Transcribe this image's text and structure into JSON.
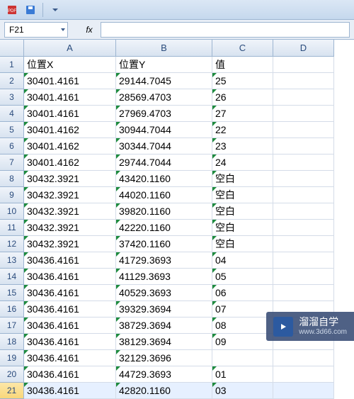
{
  "cell_reference": "F21",
  "fx_label": "fx",
  "columns": [
    "A",
    "B",
    "C",
    "D"
  ],
  "headers": {
    "A": "位置X",
    "B": "位置Y",
    "C": "值"
  },
  "rows": [
    {
      "n": 1,
      "A": "位置X",
      "B": "位置Y",
      "C": "值",
      "ind": false
    },
    {
      "n": 2,
      "A": "30401.4161",
      "B": "29144.7045",
      "C": "25",
      "ind": true
    },
    {
      "n": 3,
      "A": "30401.4161",
      "B": "28569.4703",
      "C": "26",
      "ind": true
    },
    {
      "n": 4,
      "A": "30401.4161",
      "B": "27969.4703",
      "C": "27",
      "ind": true
    },
    {
      "n": 5,
      "A": "30401.4162",
      "B": "30944.7044",
      "C": "22",
      "ind": true
    },
    {
      "n": 6,
      "A": "30401.4162",
      "B": "30344.7044",
      "C": "23",
      "ind": true
    },
    {
      "n": 7,
      "A": "30401.4162",
      "B": "29744.7044",
      "C": "24",
      "ind": true
    },
    {
      "n": 8,
      "A": "30432.3921",
      "B": "43420.1160",
      "C": "空白",
      "ind": true
    },
    {
      "n": 9,
      "A": "30432.3921",
      "B": "44020.1160",
      "C": "空白",
      "ind": true
    },
    {
      "n": 10,
      "A": "30432.3921",
      "B": "39820.1160",
      "C": "空白",
      "ind": true
    },
    {
      "n": 11,
      "A": "30432.3921",
      "B": "42220.1160",
      "C": "空白",
      "ind": true
    },
    {
      "n": 12,
      "A": "30432.3921",
      "B": "37420.1160",
      "C": "空白",
      "ind": true
    },
    {
      "n": 13,
      "A": "30436.4161",
      "B": "41729.3693",
      "C": "04",
      "ind": true
    },
    {
      "n": 14,
      "A": "30436.4161",
      "B": "41129.3693",
      "C": "05",
      "ind": true
    },
    {
      "n": 15,
      "A": "30436.4161",
      "B": "40529.3693",
      "C": "06",
      "ind": true
    },
    {
      "n": 16,
      "A": "30436.4161",
      "B": "39329.3694",
      "C": "07",
      "ind": true
    },
    {
      "n": 17,
      "A": "30436.4161",
      "B": "38729.3694",
      "C": "08",
      "ind": true
    },
    {
      "n": 18,
      "A": "30436.4161",
      "B": "38129.3694",
      "C": "09",
      "ind": true
    },
    {
      "n": 19,
      "A": "30436.4161",
      "B": "32129.3696",
      "C": "",
      "ind": true
    },
    {
      "n": 20,
      "A": "30436.4161",
      "B": "44729.3693",
      "C": "01",
      "ind": true
    },
    {
      "n": 21,
      "A": "30436.4161",
      "B": "42820.1160",
      "C": "03",
      "ind": true
    }
  ],
  "selected_row": 21,
  "watermark": {
    "text": "溜溜自学",
    "url": "www.3d66.com"
  }
}
